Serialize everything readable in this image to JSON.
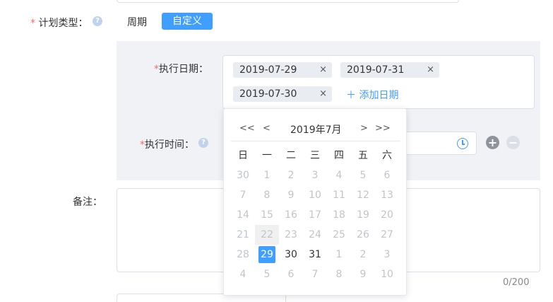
{
  "form": {
    "plan_type": {
      "required": "*",
      "label": "计划类型：",
      "help": "?",
      "tabs": [
        "周期",
        "自定义"
      ],
      "active_tab": "自定义"
    },
    "exec_date": {
      "required": "*",
      "label": "执行日期：",
      "tags": [
        {
          "label": "2019-07-29",
          "remove": "×"
        },
        {
          "label": "2019-07-31",
          "remove": "×"
        },
        {
          "label": "2019-07-30",
          "remove": "×"
        }
      ],
      "add_label": "＋ 添加日期"
    },
    "exec_time": {
      "required": "*",
      "label": "执行时间：",
      "help": "?",
      "add": "+",
      "remove": "−"
    },
    "remark": {
      "label": "备注：",
      "counter": "0/200"
    }
  },
  "calendar": {
    "prev_year": "<<",
    "prev_month": "<",
    "title": "2019年7月",
    "next_month": ">",
    "next_year": ">>",
    "weekdays": [
      "日",
      "一",
      "二",
      "三",
      "四",
      "五",
      "六"
    ],
    "weeks": [
      [
        {
          "d": "30",
          "cur": false
        },
        {
          "d": "1",
          "cur": false
        },
        {
          "d": "2",
          "cur": false
        },
        {
          "d": "3",
          "cur": false
        },
        {
          "d": "4",
          "cur": false
        },
        {
          "d": "5",
          "cur": false
        },
        {
          "d": "6",
          "cur": false
        }
      ],
      [
        {
          "d": "7",
          "cur": false
        },
        {
          "d": "8",
          "cur": false
        },
        {
          "d": "9",
          "cur": false
        },
        {
          "d": "10",
          "cur": false
        },
        {
          "d": "11",
          "cur": false
        },
        {
          "d": "12",
          "cur": false
        },
        {
          "d": "13",
          "cur": false
        }
      ],
      [
        {
          "d": "14",
          "cur": false
        },
        {
          "d": "15",
          "cur": false
        },
        {
          "d": "16",
          "cur": false
        },
        {
          "d": "17",
          "cur": false
        },
        {
          "d": "18",
          "cur": false
        },
        {
          "d": "19",
          "cur": false
        },
        {
          "d": "20",
          "cur": false
        }
      ],
      [
        {
          "d": "21",
          "cur": false
        },
        {
          "d": "22",
          "cur": false,
          "hover": true
        },
        {
          "d": "23",
          "cur": false
        },
        {
          "d": "24",
          "cur": false
        },
        {
          "d": "25",
          "cur": false
        },
        {
          "d": "26",
          "cur": false
        },
        {
          "d": "27",
          "cur": false
        }
      ],
      [
        {
          "d": "28",
          "cur": false
        },
        {
          "d": "29",
          "cur": true,
          "selected": true
        },
        {
          "d": "30",
          "cur": true
        },
        {
          "d": "31",
          "cur": true
        },
        {
          "d": "1",
          "cur": false
        },
        {
          "d": "2",
          "cur": false
        },
        {
          "d": "3",
          "cur": false
        }
      ],
      [
        {
          "d": "4",
          "cur": false
        },
        {
          "d": "5",
          "cur": false
        },
        {
          "d": "6",
          "cur": false
        },
        {
          "d": "7",
          "cur": false
        },
        {
          "d": "8",
          "cur": false
        },
        {
          "d": "9",
          "cur": false
        },
        {
          "d": "10",
          "cur": false
        }
      ]
    ]
  },
  "colors": {
    "primary": "#409eff",
    "required": "#f56c6c",
    "panel": "#f0f2f5"
  }
}
